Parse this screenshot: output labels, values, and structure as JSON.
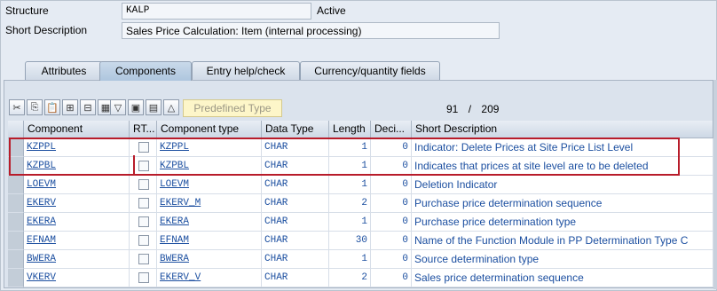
{
  "header": {
    "structure_label": "Structure",
    "structure_value": "KALP",
    "status": "Active",
    "short_desc_label": "Short Description",
    "short_desc_value": "Sales Price Calculation: Item (internal processing)"
  },
  "tabs": [
    {
      "label": "Attributes",
      "active": false
    },
    {
      "label": "Components",
      "active": true
    },
    {
      "label": "Entry help/check",
      "active": false
    },
    {
      "label": "Currency/quantity fields",
      "active": false
    }
  ],
  "toolbar": {
    "icons": [
      "cut-icon",
      "copy-icon",
      "paste-icon",
      "insert-row-icon",
      "delete-row-icon",
      "append-row-icon",
      "filter-icon",
      "select-icon",
      "detail-icon",
      "up-icon"
    ],
    "predefined_type_label": "Predefined Type",
    "current_row": "91",
    "separator": "/",
    "total_rows": "209"
  },
  "table": {
    "columns": [
      "Component",
      "RT...",
      "Component type",
      "Data Type",
      "Length",
      "Deci...",
      "Short Description"
    ],
    "rows": [
      {
        "component": "KZPPL",
        "component_type": "KZPPL",
        "data_type": "CHAR",
        "length": "1",
        "decimals": "0",
        "short_description": "Indicator: Delete Prices at Site Price List Level"
      },
      {
        "component": "KZPBL",
        "component_type": "KZPBL",
        "data_type": "CHAR",
        "length": "1",
        "decimals": "0",
        "short_description": "Indicates that prices at site level are to be deleted"
      },
      {
        "component": "LOEVM",
        "component_type": "LOEVM",
        "data_type": "CHAR",
        "length": "1",
        "decimals": "0",
        "short_description": "Deletion Indicator"
      },
      {
        "component": "EKERV",
        "component_type": "EKERV_M",
        "data_type": "CHAR",
        "length": "2",
        "decimals": "0",
        "short_description": "Purchase price determination sequence"
      },
      {
        "component": "EKERA",
        "component_type": "EKERA",
        "data_type": "CHAR",
        "length": "1",
        "decimals": "0",
        "short_description": "Purchase price determination type"
      },
      {
        "component": "EFNAM",
        "component_type": "EFNAM",
        "data_type": "CHAR",
        "length": "30",
        "decimals": "0",
        "short_description": "Name of the Function Module in PP Determination Type C"
      },
      {
        "component": "BWERA",
        "component_type": "BWERA",
        "data_type": "CHAR",
        "length": "1",
        "decimals": "0",
        "short_description": "Source determination type"
      },
      {
        "component": "VKERV",
        "component_type": "EKERV_V",
        "data_type": "CHAR",
        "length": "2",
        "decimals": "0",
        "short_description": "Sales price determination sequence"
      }
    ]
  },
  "colors": {
    "highlight": "#b81c2a",
    "link": "#1c4fa0",
    "background": "#e5ebf3"
  }
}
